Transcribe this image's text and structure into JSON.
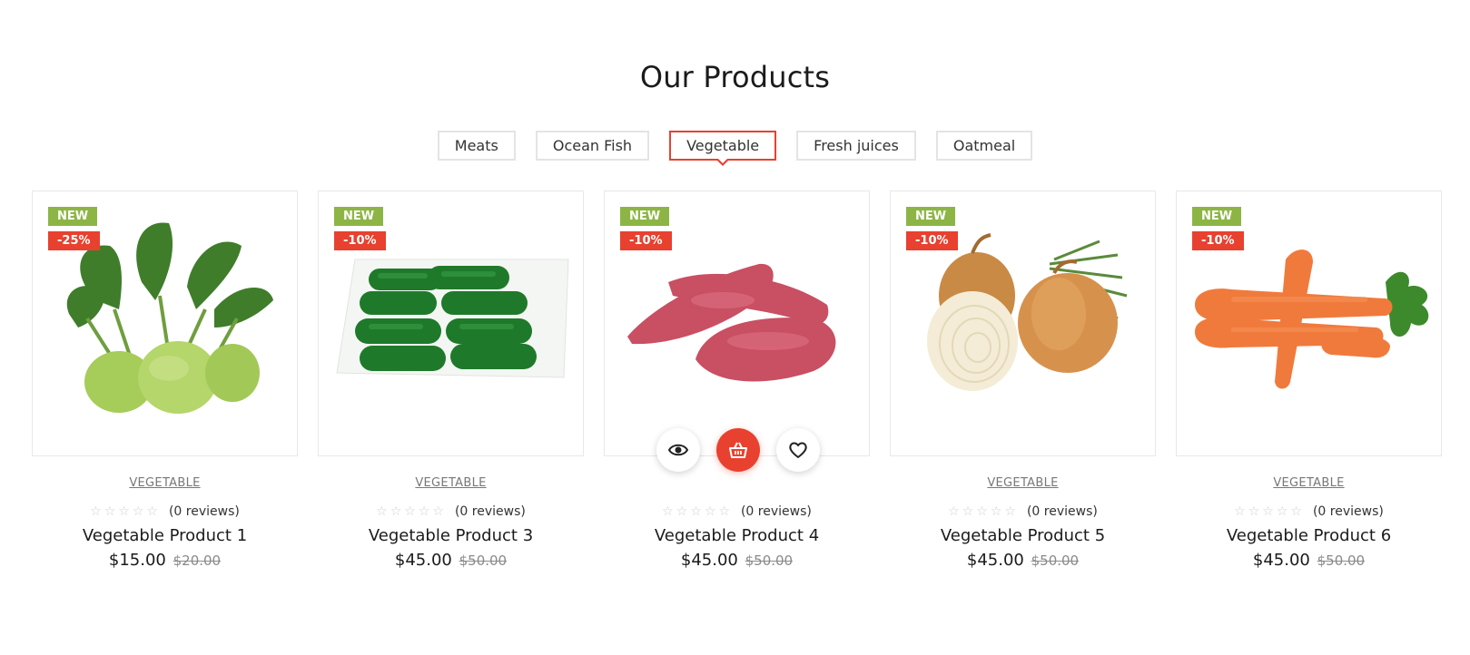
{
  "section": {
    "title": "Our Products"
  },
  "tabs": [
    {
      "label": "Meats",
      "active": false
    },
    {
      "label": "Ocean Fish",
      "active": false
    },
    {
      "label": "Vegetable",
      "active": true
    },
    {
      "label": "Fresh juices",
      "active": false
    },
    {
      "label": "Oatmeal",
      "active": false
    }
  ],
  "colors": {
    "accent": "#e8412f",
    "new_badge": "#8db545"
  },
  "products": [
    {
      "name": "Vegetable Product 1",
      "category": "VEGETABLE",
      "badge_new": "NEW",
      "badge_discount": "-25%",
      "reviews": "(0  reviews)",
      "price": "$15.00",
      "old_price": "$20.00",
      "image": "kohlrabi"
    },
    {
      "name": "Vegetable Product 3",
      "category": "VEGETABLE",
      "badge_new": "NEW",
      "badge_discount": "-10%",
      "reviews": "(0  reviews)",
      "price": "$45.00",
      "old_price": "$50.00",
      "image": "cucumbers"
    },
    {
      "name": "Vegetable Product 4",
      "category": "",
      "badge_new": "NEW",
      "badge_discount": "-10%",
      "reviews": "(0  reviews)",
      "price": "$45.00",
      "old_price": "$50.00",
      "image": "sweet-potatoes",
      "hovered": true
    },
    {
      "name": "Vegetable Product 5",
      "category": "VEGETABLE",
      "badge_new": "NEW",
      "badge_discount": "-10%",
      "reviews": "(0  reviews)",
      "price": "$45.00",
      "old_price": "$50.00",
      "image": "onions"
    },
    {
      "name": "Vegetable Product 6",
      "category": "VEGETABLE",
      "badge_new": "NEW",
      "badge_discount": "-10%",
      "reviews": "(0  reviews)",
      "price": "$45.00",
      "old_price": "$50.00",
      "image": "carrots"
    }
  ],
  "hover_actions": [
    "eye-icon",
    "basket-icon",
    "heart-icon"
  ]
}
